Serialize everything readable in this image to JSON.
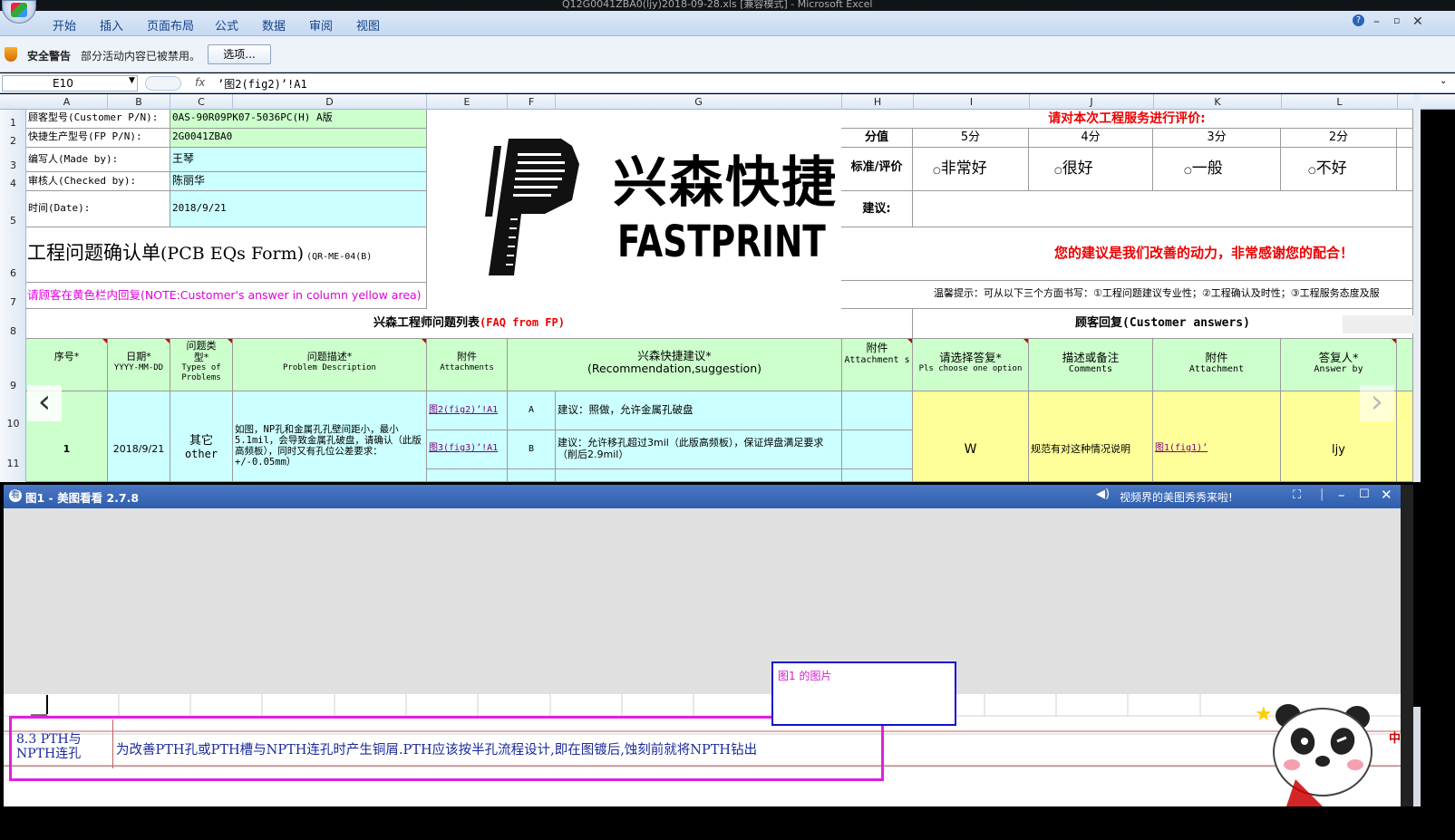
{
  "window": {
    "title": "Q12G0041ZBA0(ljy)2018-09-28.xls [兼容模式] - Microsoft Excel"
  },
  "ribbon": {
    "tabs": [
      "开始",
      "插入",
      "页面布局",
      "公式",
      "数据",
      "审阅",
      "视图"
    ]
  },
  "security": {
    "title": "安全警告",
    "message": "部分活动内容已被禁用。",
    "options_label": "选项..."
  },
  "formula_bar": {
    "name_box": "E10",
    "fx": "fx",
    "content": "’图2(fig2)’!A1"
  },
  "columns": [
    "A",
    "B",
    "C",
    "D",
    "E",
    "F",
    "G",
    "H",
    "I",
    "J",
    "K",
    "L"
  ],
  "rows": [
    "1",
    "2",
    "3",
    "4",
    "5",
    "6",
    "7",
    "8",
    "9",
    "10",
    "11"
  ],
  "header_info": {
    "customer_pn_label": "顾客型号(Customer P/N):",
    "customer_pn": "0AS-90R09PK07-5036PC(H) A版",
    "fp_pn_label": "快捷生产型号(FP P/N):",
    "fp_pn": "2G0041ZBA0",
    "made_by_label": "编写人(Made by):",
    "made_by": "王琴",
    "checked_by_label": "审核人(Checked by):",
    "checked_by": "陈丽华",
    "date_label": "时间(Date):",
    "date": "2018/9/21",
    "form_title": "工程问题确认单",
    "form_title_en": "(PCB EQs Form)",
    "form_code": "(QR-ME-04(B)",
    "note": "请顾客在黄色栏内回复(NOTE:Customer's answer in column yellow area)"
  },
  "logo": {
    "cn": "兴森快捷",
    "en": "FASTPRINT"
  },
  "rating": {
    "title": "请对本次工程服务进行评价:",
    "score_label": "分值",
    "scores": [
      "5分",
      "4分",
      "3分",
      "2分"
    ],
    "criteria_label": "标准/评价",
    "options": [
      "非常好",
      "很好",
      "一般",
      "不好"
    ],
    "suggestion_label": "建议:",
    "thanks": "您的建议是我们改善的动力，非常感谢您的配合！",
    "tip": "温馨提示：可从以下三个方面书写：①工程问题建议专业性；②工程确认及时性；③工程服务态度及服"
  },
  "section": {
    "faq_title": "兴森工程师问题列表",
    "faq_title_en": "(FAQ from FP)",
    "customer_title": "顾客回复(Customer answers)"
  },
  "table_headers": {
    "no": "序号*",
    "date": "日期*",
    "date_fmt": "YYYY-MM-DD",
    "type": "问题类型*",
    "type_en": "Types of Problems",
    "desc": "问题描述*",
    "desc_en": "Problem Description",
    "attach": "附件",
    "attach_en": "Attachments",
    "rec": "兴森快捷建议*",
    "rec_en": "(Recommendation,suggestion)",
    "attach2": "附件",
    "attach2_en": "Attachment s",
    "choose": "请选择答复*",
    "choose_en": "Pls choose one option",
    "comments": "描述或备注",
    "comments_en": "Comments",
    "attach3": "附件",
    "attach3_en": "Attachment",
    "answer_by": "答复人*",
    "answer_by_en": "Answer by"
  },
  "row1": {
    "no": "1",
    "date": "2018/9/21",
    "type": "其它",
    "type_en": "other",
    "desc": "如图，NP孔和金属孔孔壁间距小，最小5.1mil，会导致金属孔破盘，请确认（此版高频板），同时又有孔位公差要求：+/-0.05mm）",
    "attach_a": "图2(fig2)’!A1",
    "attach_b": "图3(fig3)’!A1",
    "opt_a": "A",
    "opt_b": "B",
    "rec_a": "建议：照做，允许金属孔破盘",
    "rec_b": "建议：允许移孔超过3mil（此版高频板），保证焊盘满足要求（削后2.9mil）",
    "choice": "W",
    "comment": "规范有对这种情况说明",
    "attach3": "图1(fig1)’",
    "answer_by": "ljy"
  },
  "viewer": {
    "title": "图1 - 美图看看 2.7.8",
    "promo": "视频界的美图秀秀来啦!"
  },
  "image_label": "图1 的图片",
  "lower": {
    "section_label": "8.3 PTH与NPTH连孔",
    "text": "为改善PTH孔或PTH槽与NPTH连孔时产生铜屑.PTH应该按半孔流程设计,即在图镀后,蚀刻前就将NPTH钻出"
  }
}
